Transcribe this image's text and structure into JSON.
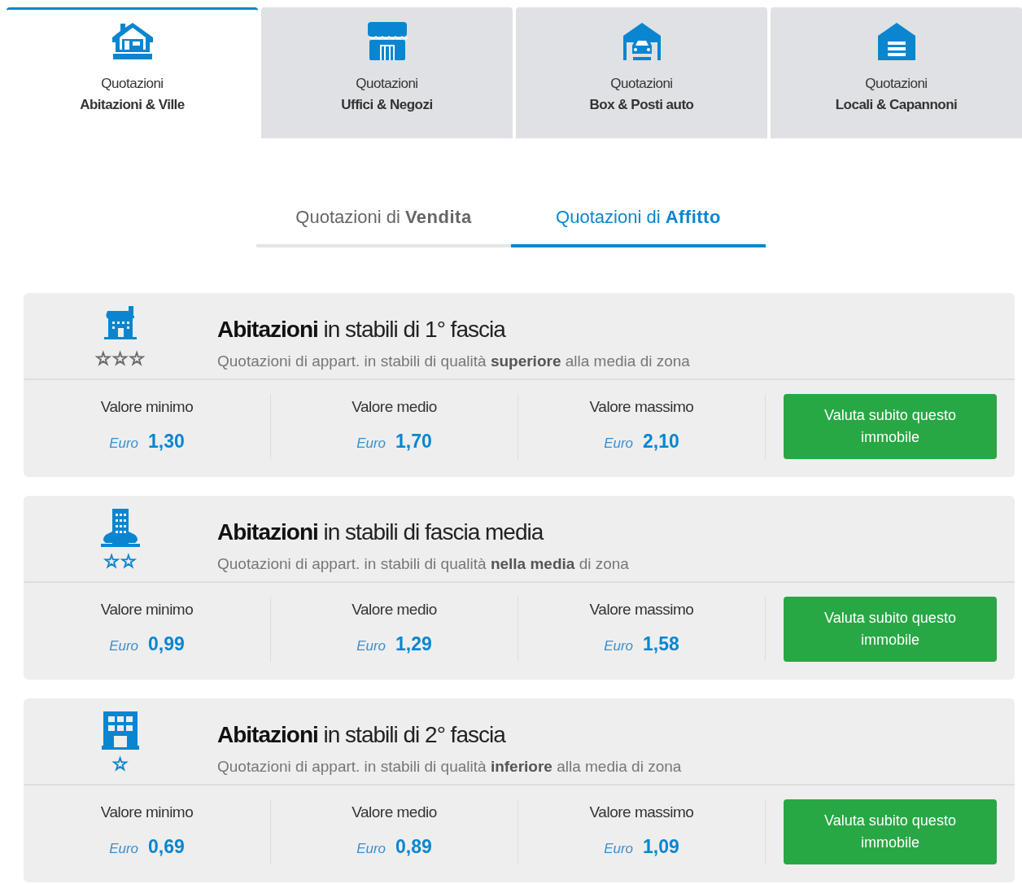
{
  "property_tabs": [
    {
      "line1": "Quotazioni",
      "line2": "Abitazioni & Ville",
      "selected": true
    },
    {
      "line1": "Quotazioni",
      "line2": "Uffici & Negozi",
      "selected": false
    },
    {
      "line1": "Quotazioni",
      "line2": "Box & Posti auto",
      "selected": false
    },
    {
      "line1": "Quotazioni",
      "line2": "Locali & Capannoni",
      "selected": false
    }
  ],
  "quote_tabs": [
    {
      "label": "Quotazioni di **Vendita**",
      "selected": false
    },
    {
      "label": "Quotazioni di **Affitto**",
      "selected": true
    }
  ],
  "categories": [
    {
      "title": "**Abitazioni** in stabili di 1° fascia",
      "description": "Quotazioni di appart. in stabili di qualità **superiore** alla media di zona",
      "stars_text": "☆☆☆",
      "color": "#6c6c6c",
      "values": [
        {
          "label": "Valore minimo",
          "currency": "Euro",
          "amount": "1,30"
        },
        {
          "label": "Valore medio",
          "currency": "Euro",
          "amount": "1,70"
        },
        {
          "label": "Valore massimo",
          "currency": "Euro",
          "amount": "2,10"
        }
      ],
      "button": "Valuta subito questo immobile"
    },
    {
      "title": "**Abitazioni** in stabili di fascia media",
      "description": "Quotazioni di appart. in stabili di qualità **nella media** di zona",
      "stars_text": "☆☆",
      "color": "#0a86d0",
      "values": [
        {
          "label": "Valore minimo",
          "currency": "Euro",
          "amount": "0,99"
        },
        {
          "label": "Valore medio",
          "currency": "Euro",
          "amount": "1,29"
        },
        {
          "label": "Valore massimo",
          "currency": "Euro",
          "amount": "1,58"
        }
      ],
      "button": "Valuta subito questo immobile"
    },
    {
      "title": "**Abitazioni** in stabili di 2° fascia",
      "description": "Quotazioni di appart. in stabili di qualità **inferiore** alla media di zona",
      "stars_text": "☆",
      "color": "#0a86d0",
      "values": [
        {
          "label": "Valore minimo",
          "currency": "Euro",
          "amount": "0,69"
        },
        {
          "label": "Valore medio",
          "currency": "Euro",
          "amount": "0,89"
        },
        {
          "label": "Valore massimo",
          "currency": "Euro",
          "amount": "1,09"
        }
      ],
      "button": "Valuta subito questo immobile"
    }
  ]
}
